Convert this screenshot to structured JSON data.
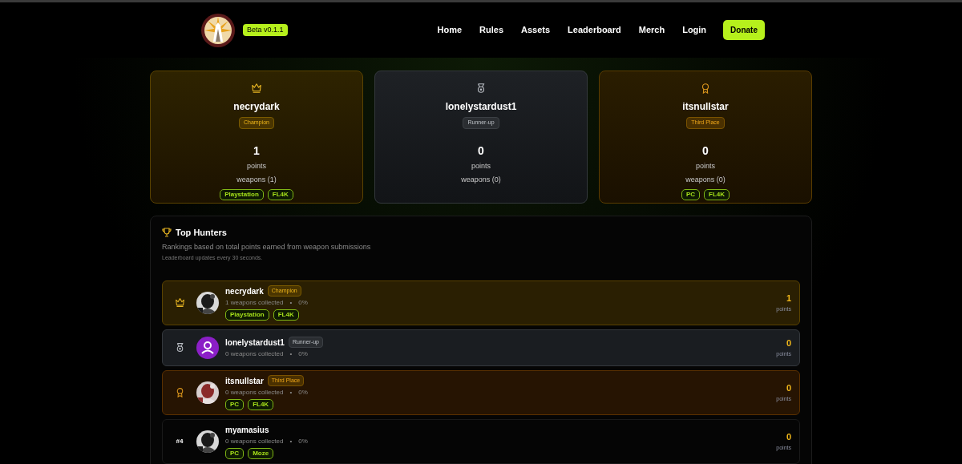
{
  "header": {
    "beta_badge": "Beta v0.1.1",
    "nav": [
      {
        "label": "Home",
        "kind": "link"
      },
      {
        "label": "Rules",
        "kind": "link"
      },
      {
        "label": "Assets",
        "kind": "link"
      },
      {
        "label": "Leaderboard",
        "kind": "link"
      },
      {
        "label": "Merch",
        "kind": "link"
      },
      {
        "label": "Login",
        "kind": "link"
      },
      {
        "label": "Donate",
        "kind": "button"
      }
    ]
  },
  "podium": [
    {
      "kind": "gold",
      "name": "necrydark",
      "badge": "Champion",
      "points": "1",
      "points_label": "points",
      "weapons": "weapons (1)",
      "tags": [
        "Playstation",
        "FL4K"
      ]
    },
    {
      "kind": "silver",
      "name": "lonelystardust1",
      "badge": "Runner-up",
      "points": "0",
      "points_label": "points",
      "weapons": "weapons (0)"
    },
    {
      "kind": "bronze",
      "name": "itsnullstar",
      "badge": "Third Place",
      "points": "0",
      "points_label": "points",
      "weapons": "weapons (0)",
      "tags": [
        "PC",
        "FL4K"
      ]
    }
  ],
  "leaderboard": {
    "title": "Top Hunters",
    "subtitle": "Rankings based on total points earned from weapon submissions",
    "note": "Leaderboard updates every 30 seconds.",
    "rows": [
      {
        "kind": "gold",
        "name": "necrydark",
        "badge": "Champion",
        "avatar": {
          "kind": "picture"
        },
        "collected": "1 weapons collected",
        "bullet": "•",
        "percent": "0%",
        "tags": [
          "Playstation",
          "FL4K"
        ],
        "points": "1",
        "points_label": "points"
      },
      {
        "kind": "silver",
        "name": "lonelystardust1",
        "badge": "Runner-up",
        "avatar": {
          "kind": "default"
        },
        "collected": "0 weapons collected",
        "bullet": "•",
        "percent": "0%",
        "points": "0",
        "points_label": "points"
      },
      {
        "kind": "bronze",
        "name": "itsnullstar",
        "badge": "Third Place",
        "avatar": {
          "kind": "picture"
        },
        "collected": "0 weapons collected",
        "bullet": "•",
        "percent": "0%",
        "tags": [
          "PC",
          "FL4K"
        ],
        "points": "0",
        "points_label": "points"
      },
      {
        "kind": "plain",
        "rank_label": "#4",
        "name": "myamasius",
        "avatar": {
          "kind": "picture"
        },
        "collected": "0 weapons collected",
        "bullet": "•",
        "percent": "0%",
        "tags": [
          "PC",
          "Moze"
        ],
        "points": "0",
        "points_label": "points"
      }
    ]
  }
}
